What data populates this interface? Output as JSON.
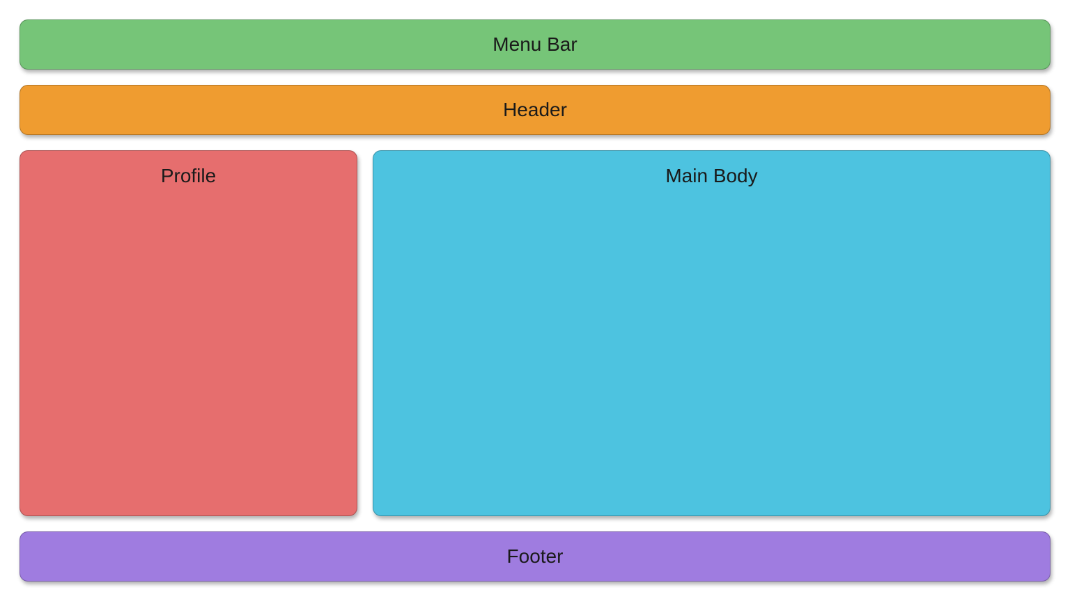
{
  "layout": {
    "menu_bar": {
      "label": "Menu Bar",
      "color": "#76c578"
    },
    "header": {
      "label": "Header",
      "color": "#ef9c30"
    },
    "profile": {
      "label": "Profile",
      "color": "#e66e6e"
    },
    "main_body": {
      "label": "Main Body",
      "color": "#4dc3e0"
    },
    "footer": {
      "label": "Footer",
      "color": "#9f7ce0"
    }
  }
}
